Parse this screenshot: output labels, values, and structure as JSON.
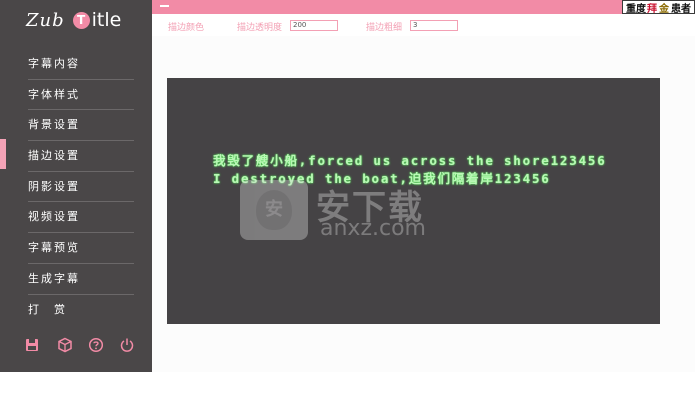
{
  "app": {
    "logo_part1": "Zub",
    "logo_circle": "T",
    "logo_part2": "itle"
  },
  "sidebar": {
    "items": [
      {
        "label": "字幕内容",
        "active": false
      },
      {
        "label": "字体样式",
        "active": false
      },
      {
        "label": "背景设置",
        "active": false
      },
      {
        "label": "描边设置",
        "active": true
      },
      {
        "label": "阴影设置",
        "active": false
      },
      {
        "label": "视频设置",
        "active": false
      },
      {
        "label": "字幕预览",
        "active": false
      },
      {
        "label": "生成字幕",
        "active": false
      },
      {
        "label": "打　赏",
        "active": false
      }
    ],
    "icons": [
      "save-icon",
      "package-icon",
      "help-icon",
      "power-icon"
    ]
  },
  "topbar": {
    "banner_part1": "重度",
    "banner_part2": "拜",
    "banner_part3": "金",
    "banner_part4": "患者"
  },
  "controls": {
    "stroke_color_label": "描边颜色",
    "stroke_opacity_label": "描边透明度",
    "stroke_opacity_value": "200",
    "stroke_width_label": "描边粗细",
    "stroke_width_value": "3"
  },
  "preview": {
    "line1": "我毁了艘小船,forced us across the shore123456",
    "line2": "I destroyed the boat,迫我们隔着岸123456",
    "text_color": "#baf7b6",
    "stroke_color": "#5be85f",
    "background_color": "#454345"
  },
  "watermark": {
    "shield_char": "安",
    "title": "安下载",
    "url": "anxz.com"
  },
  "colors": {
    "accent": "#f28ba6",
    "sidebar_bg": "#4a4748"
  }
}
